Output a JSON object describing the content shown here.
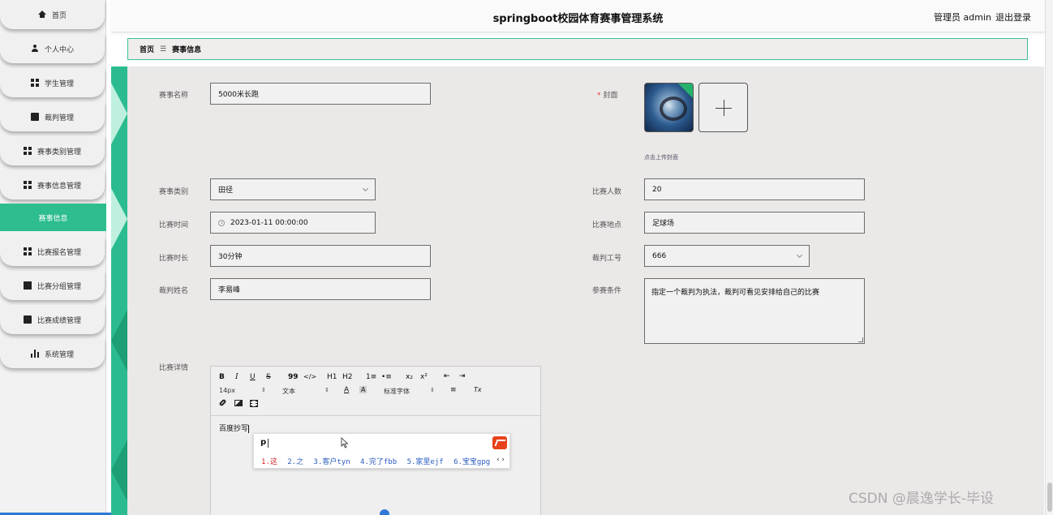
{
  "app": {
    "title": "springboot校园体育赛事管理系统",
    "user_label": "管理员 admin",
    "logout_label": "退出登录"
  },
  "sidebar": {
    "items": [
      {
        "label": "首页",
        "icon": "home-icon"
      },
      {
        "label": "个人中心",
        "icon": "user-icon"
      },
      {
        "label": "学生管理",
        "icon": "grid-icon"
      },
      {
        "label": "裁判管理",
        "icon": "book-icon"
      },
      {
        "label": "赛事类别管理",
        "icon": "grid-icon"
      },
      {
        "label": "赛事信息管理",
        "icon": "grid-icon"
      },
      {
        "label": "赛事信息",
        "icon": ""
      },
      {
        "label": "比赛报名管理",
        "icon": "grid-icon"
      },
      {
        "label": "比赛分组管理",
        "icon": "monitor-icon"
      },
      {
        "label": "比赛成绩管理",
        "icon": "chat-icon"
      },
      {
        "label": "系统管理",
        "icon": "bar-chart-icon"
      }
    ],
    "active_index": 6,
    "active_color": "#2dbd8f"
  },
  "breadcrumb": {
    "home": "首页",
    "separator": "☰",
    "current": "赛事信息"
  },
  "form": {
    "event_name": {
      "label": "赛事名称",
      "value": "5000米长跑"
    },
    "cover": {
      "label": "封面",
      "required_mark": "*",
      "hint": "点击上传封面"
    },
    "category": {
      "label": "赛事类别",
      "value": "田径"
    },
    "participants": {
      "label": "比赛人数",
      "value": "20"
    },
    "time": {
      "label": "比赛时间",
      "value": "2023-01-11 00:00:00"
    },
    "location": {
      "label": "比赛地点",
      "value": "足球场"
    },
    "duration": {
      "label": "比赛时长",
      "value": "30分钟"
    },
    "referee_id": {
      "label": "裁判工号",
      "value": "666"
    },
    "referee_name": {
      "label": "裁判姓名",
      "value": "李易峰"
    },
    "conditions": {
      "label": "参赛条件",
      "value": "指定一个裁判为执法，裁判可看见安排给自己的比赛"
    },
    "details": {
      "label": "比赛详情",
      "content": "百度抄写"
    }
  },
  "editor_toolbar": {
    "bold": "B",
    "italic": "I",
    "underline": "U",
    "strike": "S",
    "quote": "99",
    "code": "</>",
    "h1": "H1",
    "h2": "H2",
    "ordered_list": "1≡",
    "bullet_list": "•≡",
    "subscript": "x₂",
    "superscript": "x²",
    "outdent": "⇤",
    "indent": "⇥",
    "font_size": "14px",
    "text_type": "文本",
    "font_color": "A",
    "bg_color": "A",
    "font_family": "标准字体",
    "align": "≡",
    "clear_format": "Tx",
    "link": "🔗",
    "image": "▣",
    "video": "▤"
  },
  "ime": {
    "input": "p",
    "candidates": [
      "1.这",
      "2.之",
      "3.客户tyn",
      "4.完了fbb",
      "5.家里ejf",
      "6.宝宝gpg"
    ],
    "nav": "‹ ›"
  },
  "watermark": "CSDN @晨逸学长-毕设"
}
